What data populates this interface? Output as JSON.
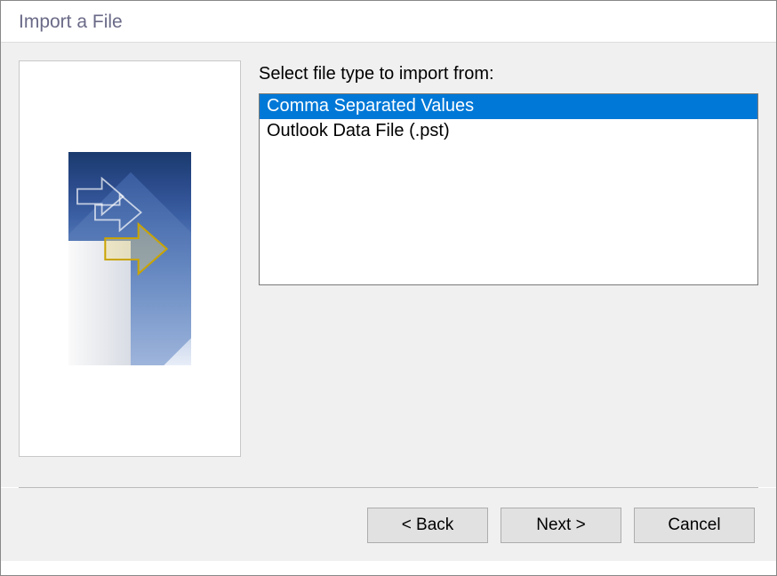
{
  "dialog": {
    "title": "Import a File",
    "instruction": "Select file type to import from:",
    "file_types": [
      {
        "label": "Comma Separated Values",
        "selected": true
      },
      {
        "label": "Outlook Data File (.pst)",
        "selected": false
      }
    ],
    "buttons": {
      "back": "< Back",
      "next": "Next >",
      "cancel": "Cancel"
    }
  }
}
